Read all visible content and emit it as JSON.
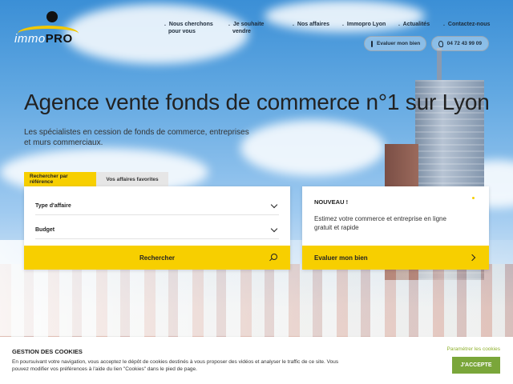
{
  "logo": {
    "prefix": "immo",
    "suffix": "PRO"
  },
  "nav": {
    "items": [
      {
        "line1": "Nous cherchons",
        "line2": "pour vous"
      },
      {
        "line1": "Je souhaite",
        "line2": "vendre"
      },
      {
        "line1": "Nos affaires",
        "line2": ""
      },
      {
        "line1": "Immopro Lyon",
        "line2": ""
      },
      {
        "line1": "Actualités",
        "line2": ""
      },
      {
        "line1": "Contactez-nous",
        "line2": ""
      }
    ],
    "evaluate_label": "Evaluer mon bien",
    "phone_label": "04 72 43 99 09"
  },
  "hero": {
    "title": "Agence vente fonds de commerce n°1 sur Lyon",
    "subtitle": "Les spécialistes en cession de fonds de commerce, entreprises et murs commerciaux."
  },
  "tabs": {
    "active": "Rechercher par référence",
    "inactive": "Vos affaires favorites"
  },
  "search": {
    "field1": "Type d'affaire",
    "field2": "Budget",
    "button": "Rechercher"
  },
  "promo": {
    "badge": "NOUVEAU !",
    "text": "Estimez votre commerce et entreprise en ligne gratuit et rapide",
    "button": "Evaluer mon bien"
  },
  "cookie": {
    "title": "GESTION DES COOKIES",
    "text": "En poursuivant votre navigation, vous acceptez le dépôt de cookies destinés à vous proposer des vidéos et analyser le traffic de ce site. Vous pouvez modifier vos préférences à l'aide du lien \"Cookies\" dans le pied de page.",
    "settings": "Paramétrer les cookies",
    "accept": "J'ACCEPTE"
  },
  "colors": {
    "accent": "#f7cf00",
    "accept_green": "#7aa63a"
  },
  "icons": {
    "search": "search-icon",
    "phone": "phone-icon",
    "evaluate": "home-icon",
    "chevron": "chevron-down-icon",
    "arrow": "chevron-right-icon"
  }
}
